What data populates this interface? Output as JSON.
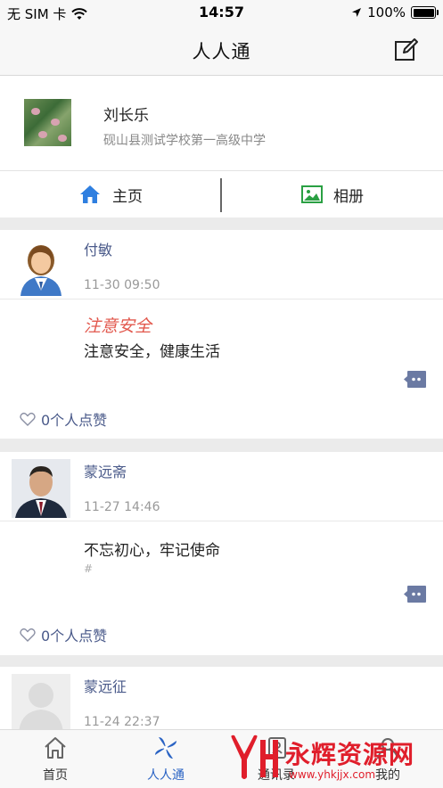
{
  "status_bar": {
    "carrier": "无 SIM 卡",
    "time": "14:57",
    "battery": "100%"
  },
  "nav": {
    "title": "人人通"
  },
  "profile": {
    "name": "刘长乐",
    "school": "砚山县测试学校第一高级中学"
  },
  "tabs": {
    "home": "主页",
    "album": "相册"
  },
  "posts": [
    {
      "author": "付敏",
      "time": "11-30 09:50",
      "title": "注意安全",
      "body": "注意安全，健康生活",
      "tag": "",
      "likes": "0个人点赞"
    },
    {
      "author": "蒙远斋",
      "time": "11-27 14:46",
      "title": "",
      "body": "不忘初心，牢记使命",
      "tag": "#",
      "likes": "0个人点赞"
    },
    {
      "author": "蒙远征",
      "time": "11-24 22:37"
    }
  ],
  "tabbar": {
    "items": [
      {
        "label": "首页",
        "icon": "home-icon"
      },
      {
        "label": "人人通",
        "icon": "pinwheel-icon"
      },
      {
        "label": "通讯录",
        "icon": "contacts-icon"
      },
      {
        "label": "我的",
        "icon": "profile-icon"
      }
    ]
  },
  "watermark": {
    "main": "永辉资源网",
    "sub": "www.yhkjjx.com"
  },
  "colors": {
    "accent": "#2a63c4",
    "name_link": "#4a5a8a",
    "title_red": "#e2584d",
    "comment_btn": "#6b7aa3",
    "album_green": "#2aa043"
  }
}
